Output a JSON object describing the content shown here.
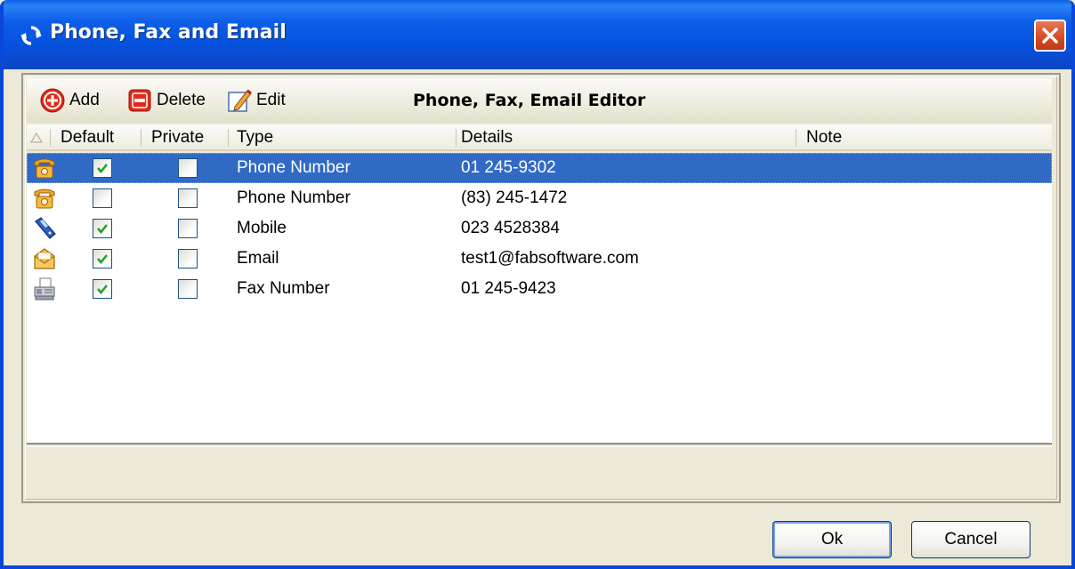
{
  "window": {
    "title": "Phone, Fax and Email",
    "close_label": "×"
  },
  "toolbar": {
    "add_label": "Add",
    "delete_label": "Delete",
    "edit_label": "Edit",
    "editor_title": "Phone, Fax, Email Editor"
  },
  "columns": {
    "default": "Default",
    "private": "Private",
    "type": "Type",
    "details": "Details",
    "note": "Note"
  },
  "rows": [
    {
      "icon": "phone-icon",
      "default": true,
      "private": false,
      "type": "Phone Number",
      "details": "01 245-9302",
      "note": "",
      "selected": true
    },
    {
      "icon": "phone-icon",
      "default": false,
      "private": false,
      "type": "Phone Number",
      "details": "(83) 245-1472",
      "note": "",
      "selected": false
    },
    {
      "icon": "mobile-icon",
      "default": true,
      "private": false,
      "type": "Mobile",
      "details": "023 4528384",
      "note": "",
      "selected": false
    },
    {
      "icon": "email-icon",
      "default": true,
      "private": false,
      "type": "Email",
      "details": "test1@fabsoftware.com",
      "note": "",
      "selected": false
    },
    {
      "icon": "fax-icon",
      "default": true,
      "private": false,
      "type": "Fax Number",
      "details": "01 245-9423",
      "note": "",
      "selected": false
    }
  ],
  "buttons": {
    "ok": "Ok",
    "cancel": "Cancel"
  },
  "colors": {
    "titlebar": "#0553e0",
    "selection": "#316ac5",
    "check": "#21a121"
  }
}
